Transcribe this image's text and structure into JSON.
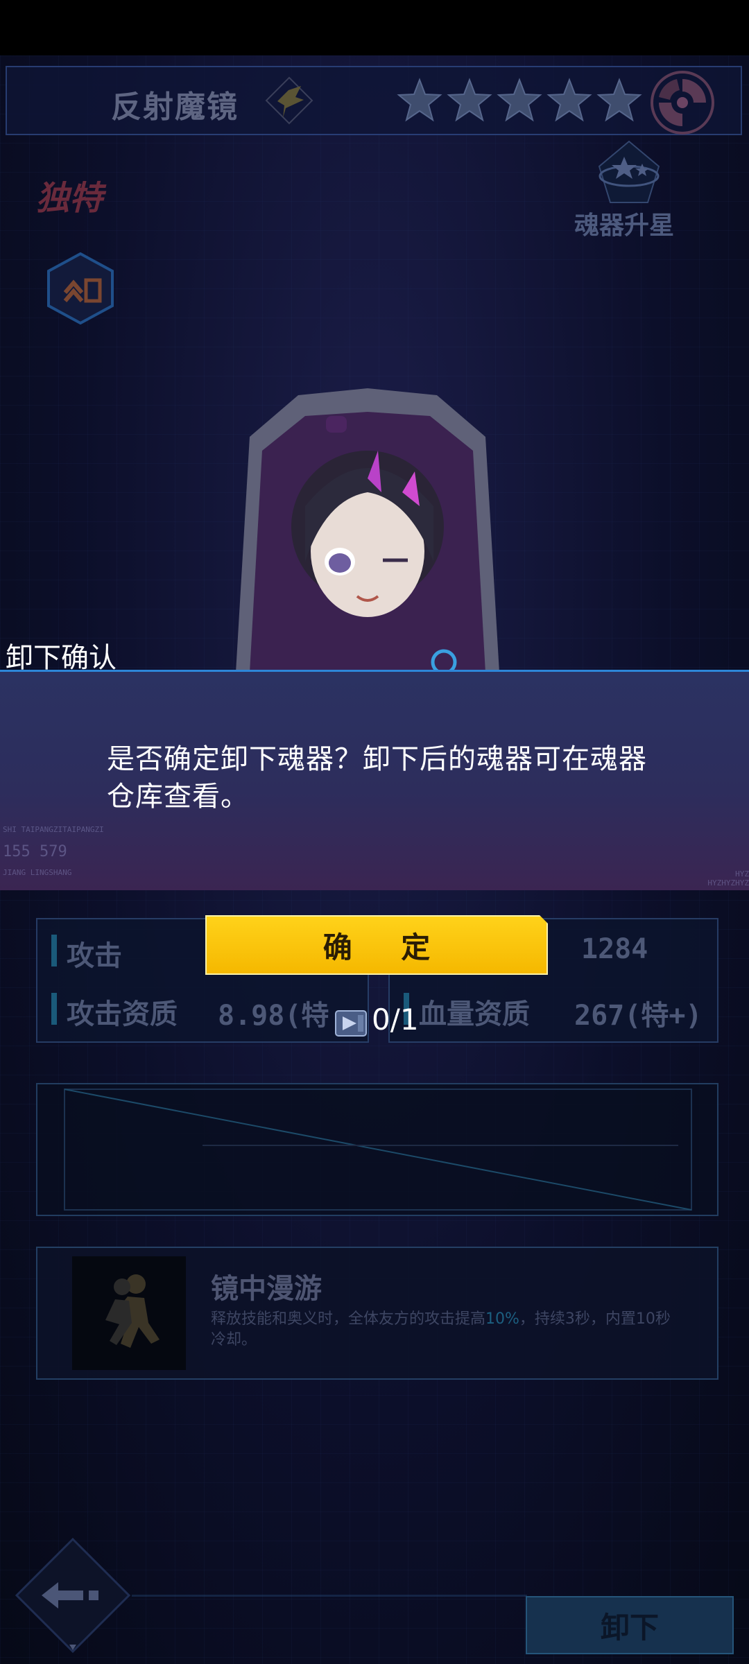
{
  "header": {
    "item_name": "反射魔镜",
    "rarity_stars": 5
  },
  "top": {
    "unique_label": "独特",
    "rankup_label": "魂器升星"
  },
  "dialog": {
    "title": "卸下确认",
    "message": "是否确定卸下魂器？卸下后的魂器可在魂器仓库查看。",
    "confirm_label": "确 定",
    "decor": {
      "left_small_top": "SHI TAIPANGZITAIPANGZI",
      "left_code": "155 579",
      "left_small_bottom": "JIANG LINGSHANG",
      "right_small": "HYZ HYZHYZHYZ"
    }
  },
  "stats": {
    "attack_label": "攻击",
    "attack_quality_label": "攻击资质",
    "attack_quality_value": "8.98(特",
    "hp_value": "1284",
    "hp_quality_label": "血量资质",
    "hp_quality_value": "267(特+)"
  },
  "cost": {
    "count": "0/1"
  },
  "skill": {
    "name": "镜中漫游",
    "desc_before": "释放技能和奥义时，全体友方的攻击提高",
    "desc_highlight": "10%",
    "desc_after": "，持续3秒，内置10秒冷却。"
  },
  "bottom": {
    "unequip_label": "卸下"
  },
  "colors": {
    "accent_yellow": "#ffd21a",
    "dialog_border": "#2d86d8",
    "background": "#070b1c"
  }
}
